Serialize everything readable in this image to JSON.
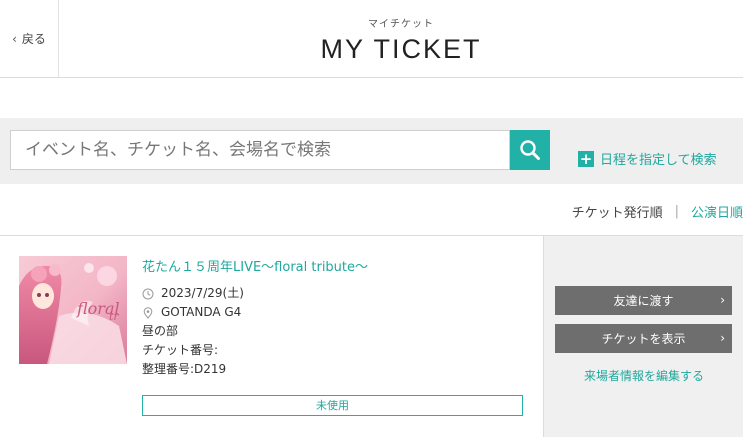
{
  "header": {
    "back_label": "戻る",
    "subtitle": "マイチケット",
    "title": "MY TICKET"
  },
  "search": {
    "placeholder": "イベント名、チケット名、会場名で検索",
    "date_search_label": "日程を指定して検索"
  },
  "sort": {
    "issue_order": "チケット発行順",
    "separator": "|",
    "performance_order": "公演日順"
  },
  "ticket": {
    "title": "花たん１５周年LIVE～floral tribute～",
    "date": "2023/7/29(土)",
    "venue": "GOTANDA G4",
    "session": "昼の部",
    "ticket_number_label": "チケット番号:",
    "entry_number": "整理番号:D219",
    "status": "未使用",
    "actions": {
      "transfer": "友達に渡す",
      "show_ticket": "チケットを表示",
      "edit_visitor": "来場者情報を編集する"
    }
  },
  "colors": {
    "accent": "#22b1a6",
    "button_dark": "#6e6e6e",
    "band": "#efefef"
  }
}
